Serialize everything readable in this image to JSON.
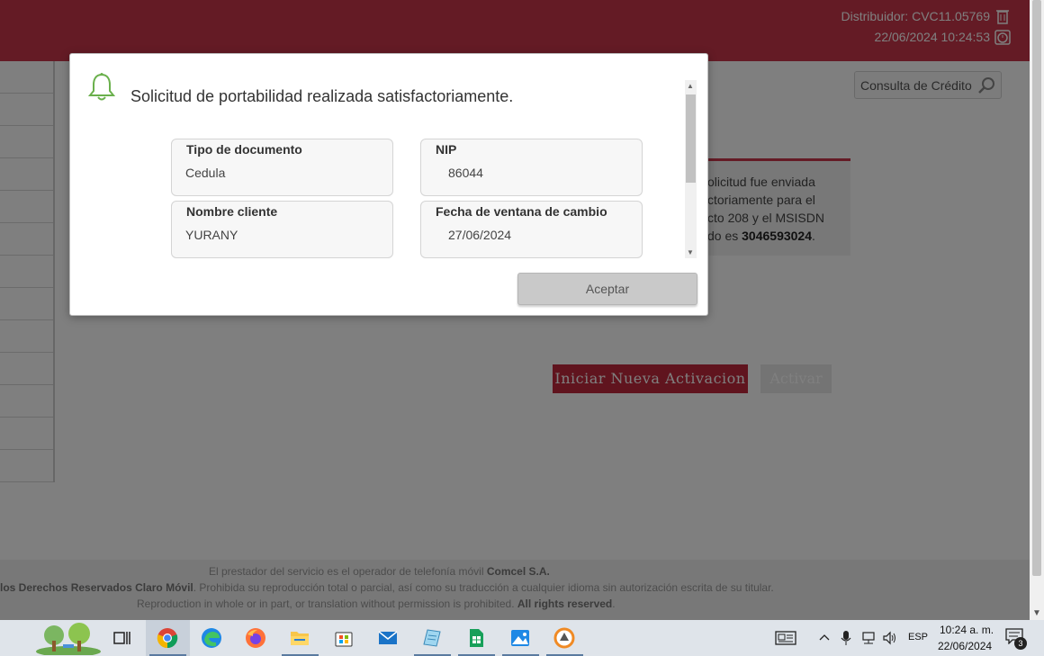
{
  "header": {
    "distribuidor": "Distribuidor: CVC11.05769",
    "datetime": "22/06/2024 10:24:53"
  },
  "search": {
    "label": "Consulta de Crédito"
  },
  "info_box": {
    "line1": "olicitud fue enviada",
    "line2": "ctoriamente para el",
    "line3": "cto 208 y el MSISDN",
    "line4_prefix": "do es ",
    "msisdn": "3046593024",
    "line4_suffix": "."
  },
  "buttons": {
    "nueva": "Iniciar Nueva Activacion",
    "activar": "Activar"
  },
  "footer": {
    "line1_text": "El prestador del servicio es el operador de telefonía móvil ",
    "line1_bold": "Comcel S.A.",
    "line2_bold": "los Derechos Reservados Claro Móvil",
    "line2_text": ". Prohibida su reproducción total o parcial, así como su traducción a cualquier idioma sin autorización escrita de su titular.",
    "line3_text": "Reproduction in whole or in part, or translation without permission is prohibited. ",
    "line3_bold": "All rights reserved"
  },
  "modal": {
    "message": "Solicitud de portabilidad realizada satisfactoriamente.",
    "fields": {
      "tipo_label": "Tipo de documento",
      "tipo_value": "Cedula",
      "nip_label": "NIP",
      "nip_value": "86044",
      "nombre_label": "Nombre cliente",
      "nombre_value": "YURANY",
      "fecha_label": "Fecha de ventana de cambio",
      "fecha_value": "27/06/2024"
    },
    "accept": "Aceptar"
  },
  "taskbar": {
    "apps": [
      "task-view-icon",
      "chrome-icon",
      "edge-icon",
      "firefox-icon",
      "file-explorer-icon",
      "store-icon",
      "mail-icon",
      "notepad-icon",
      "sheets-icon",
      "photos-icon",
      "app-icon"
    ],
    "language": "ESP",
    "time": "10:24 a. m.",
    "date": "22/06/2024",
    "notifications": "3"
  },
  "colors": {
    "brand": "#c8374a",
    "button_red": "#c0283c",
    "bell": "#6ab04c"
  }
}
